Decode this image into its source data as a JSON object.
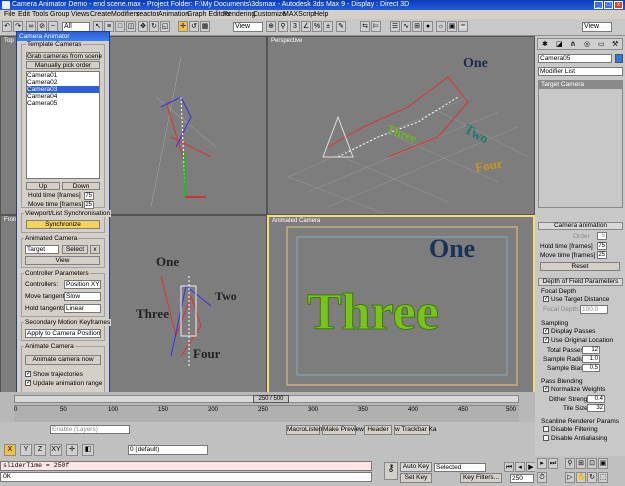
{
  "window": {
    "title": "Camera Animator Demo - end scene.max - Project Folder: F:\\My Documents\\3dsmax - Autodesk 3ds Max 9 - Display : Direct 3D"
  },
  "menu": [
    "File",
    "Edit",
    "Tools",
    "Group",
    "Views",
    "Create",
    "Modifiers",
    "reactor",
    "Animation",
    "Graph Editors",
    "Rendering",
    "Customize",
    "MAXScript",
    "Help"
  ],
  "toolbar": {
    "selection_filter": "All",
    "ref_coord": "View",
    "named_sel": "View"
  },
  "viewports": {
    "top_label": "Top",
    "perspective_label": "Perspective",
    "front_label": "Front",
    "animated_camera_label": "Animated Camera",
    "words": [
      "One",
      "Two",
      "Three",
      "Four"
    ]
  },
  "dialog": {
    "title": "Camera Animator",
    "template_cameras": {
      "label": "Template Cameras",
      "grab_button": "Grab cameras from scene",
      "manual_pick": "Manually pick order",
      "cameras": [
        "Camera01",
        "Camera02",
        "Camera03",
        "Camera04",
        "Camera05"
      ],
      "selected_index": 2,
      "up": "Up",
      "down": "Down",
      "hold_label": "Hold time [frames]",
      "hold_value": "75",
      "move_label": "Move time [frames]",
      "move_value": "25"
    },
    "sync": {
      "label": "Viewport/List Synchronisation",
      "button": "Synchronize"
    },
    "animated_camera": {
      "label": "Animated Camera",
      "target": "Target",
      "select": "Select",
      "x": "x",
      "view": "View"
    },
    "controller": {
      "label": "Controller Parameters",
      "controllers_label": "Controllers:",
      "controllers_value": "Position XYZ",
      "move_tangents_label": "Move tangents:",
      "move_tangents_value": "Slow",
      "hold_tangents_label": "Hold tangents:",
      "hold_tangents_value": "Linear"
    },
    "secondary": {
      "label": "Secondary Motion Keyframes",
      "apply": "Apply to Camera Position"
    },
    "animate": {
      "label": "Animate Camera",
      "button": "Animate camera now",
      "show_traj": "Show trajectories",
      "update_range": "Update animation range"
    }
  },
  "command_panel": {
    "object_name": "Camera05",
    "modifier_list": "Modifier List",
    "stack_item": "Target Camera",
    "camera_animation": {
      "label": "Camera animation",
      "order_label": "Order",
      "order_value": "5",
      "hold_label": "Hold time [frames]",
      "hold_value": "75",
      "move_label": "Move time [frames]",
      "move_value": "25",
      "reset": "Reset"
    },
    "dof": {
      "label": "Depth of Field Parameters",
      "focal_depth": "Focal Depth",
      "use_target": "Use Target Distance",
      "focal_depth_label": "Focal Depth:",
      "focal_depth_value": "100.0",
      "sampling": "Sampling",
      "display_passes": "Display Passes",
      "use_orig": "Use Original Location",
      "total_passes_label": "Total Passes",
      "total_passes": "12",
      "sample_radius_label": "Sample Radius",
      "sample_radius": "1.0",
      "sample_bias_label": "Sample Bias",
      "sample_bias": "0.5",
      "pass_blending": "Pass Blending",
      "normalize": "Normalize Weights",
      "dither_label": "Dither Strength",
      "dither": "0.4",
      "tile_label": "Tile Size",
      "tile": "32",
      "scanline": "Scanline Renderer Params",
      "disable_filtering": "Disable Filtering",
      "disable_aa": "Disable Antialiasing"
    }
  },
  "timeline": {
    "slider": "250 / 500",
    "ticks": [
      "0",
      "50",
      "100",
      "150",
      "200",
      "250",
      "300",
      "350",
      "400",
      "450",
      "500"
    ]
  },
  "bottom": {
    "layer_field": "Enable (Layers)",
    "layer_name": "0 (default)",
    "maxscript_listener": "MacroListener",
    "make_preview": "Make Preview",
    "header": "Header",
    "trackbar": "w Trackbar Ka",
    "script_line1": "sliderTime = 250f",
    "script_line2": "OK",
    "auto_key": "Auto Key",
    "set_key": "Set Key",
    "selected": "Selected",
    "key_filters": "Key Filters...",
    "frame": "250"
  }
}
